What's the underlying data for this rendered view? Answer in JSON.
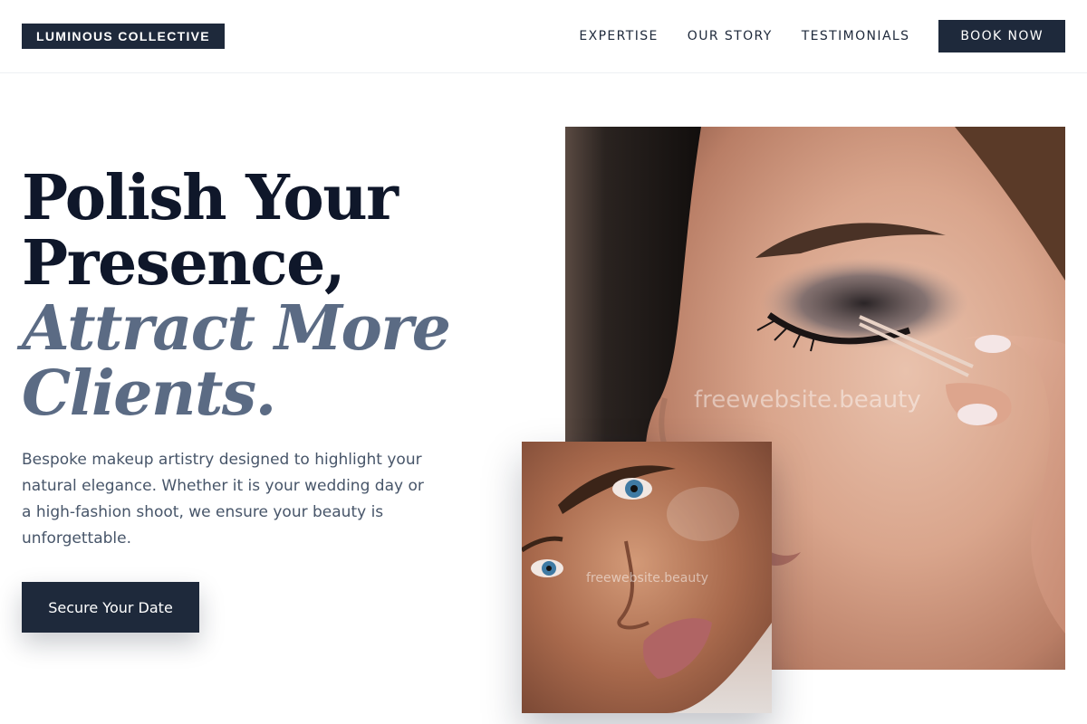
{
  "header": {
    "brand": "LUMINOUS COLLECTIVE",
    "nav": [
      "EXPERTISE",
      "OUR STORY",
      "TESTIMONIALS"
    ],
    "book_label": "BOOK NOW"
  },
  "hero": {
    "headline_line1": "Polish Your",
    "headline_line2": "Presence,",
    "accent_line1": "Attract More",
    "accent_line2": "Clients.",
    "lede": "Bespoke makeup artistry designed to highlight your natural elegance. Whether it is your wedding day or a high-fashion shoot, we ensure your beauty is unforgettable.",
    "cta_label": "Secure Your Date"
  },
  "images": {
    "main_watermark": "freewebsite.beauty",
    "small_watermark": "freewebsite.beauty"
  },
  "colors": {
    "navy": "#1e293b",
    "accent_slate": "#5b6b84",
    "body_text": "#475569"
  }
}
